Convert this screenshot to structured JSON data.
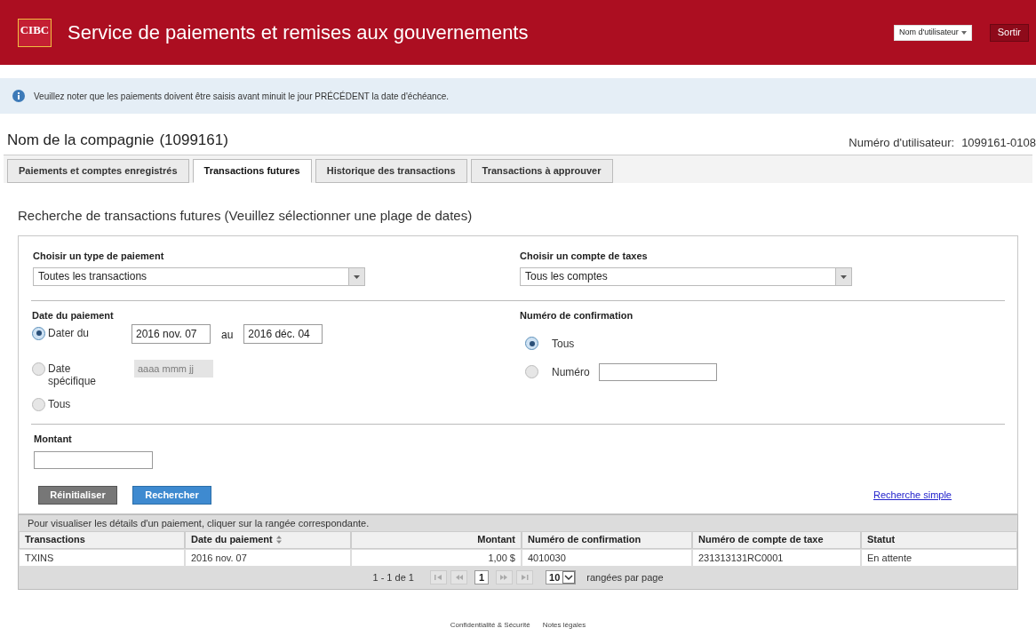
{
  "header": {
    "logo": "CIBC",
    "title": "Service de paiements et remises aux gouvernements",
    "user_menu": "Nom d'utilisateur",
    "logout": "Sortir"
  },
  "notice": "Veuillez noter que les paiements doivent être saisis avant minuit le jour PRÉCÉDENT la date d'échéance.",
  "company": {
    "name": "Nom de la compagnie",
    "number": "(1099161)",
    "user_label": "Numéro d'utilisateur:",
    "user_id": "1099161-0108"
  },
  "tabs": [
    {
      "label": "Paiements et comptes enregistrés",
      "selected": false
    },
    {
      "label": "Transactions futures",
      "selected": true
    },
    {
      "label": "Historique des transactions",
      "selected": false
    },
    {
      "label": "Transactions à approuver",
      "selected": false
    }
  ],
  "search_title": "Recherche de transactions futures (Veuillez sélectionner une plage de dates)",
  "form": {
    "payment_type": {
      "label": "Choisir un type de paiement",
      "value": "Toutes les transactions"
    },
    "tax_account": {
      "label": "Choisir un compte de taxes",
      "value": "Tous les comptes"
    },
    "date": {
      "label": "Date du paiement",
      "options": [
        {
          "kind": "range",
          "label": "Dater du",
          "selected": true,
          "from": "2016 nov. 07",
          "separator": "au",
          "to": "2016 déc. 04"
        },
        {
          "kind": "single",
          "label": "Date spécifique",
          "selected": false,
          "placeholder": "aaaa mmm jj",
          "disabled": true
        },
        {
          "kind": "plain",
          "label": "Tous",
          "selected": false
        }
      ]
    },
    "confirmation": {
      "label": "Numéro de confirmation",
      "options": [
        {
          "kind": "plain",
          "label": "Tous",
          "selected": true
        },
        {
          "kind": "input",
          "label": "Numéro",
          "selected": false
        }
      ]
    },
    "amount": {
      "label": "Montant"
    },
    "reset": "Réinitialiser",
    "search": "Rechercher",
    "simple_link": "Recherche simple"
  },
  "table": {
    "hint": "Pour visualiser les détails d'un paiement, cliquer sur la rangée correspondante.",
    "columns": [
      {
        "label": "Transactions",
        "sortable": false,
        "kind": "text"
      },
      {
        "label": "Date du paiement",
        "sortable": true,
        "kind": "text"
      },
      {
        "label": "Montant",
        "sortable": false,
        "kind": "amount"
      },
      {
        "label": "Numéro de confirmation",
        "sortable": false,
        "kind": "text"
      },
      {
        "label": "Numéro de compte de taxe",
        "sortable": false,
        "kind": "text"
      },
      {
        "label": "Statut",
        "sortable": false,
        "kind": "text"
      }
    ],
    "rows": [
      [
        "TXINS",
        "2016 nov. 07",
        "1,00 $",
        "4010030",
        "231313131RC0001",
        "En attente"
      ]
    ],
    "pager": {
      "range": "1 - 1 de 1",
      "page": "1",
      "per_page": "10",
      "per_page_label": "rangées par page"
    }
  },
  "footer": [
    "Confidentialité & Sécurité",
    "Notes légales"
  ]
}
